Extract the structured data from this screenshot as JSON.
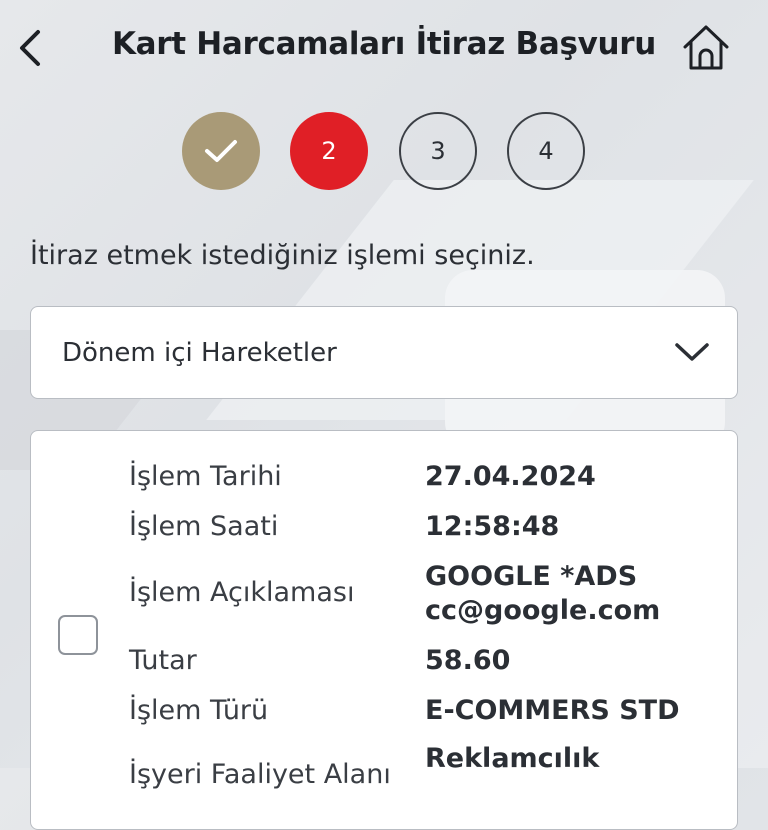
{
  "header": {
    "title": "Kart Harcamaları İtiraz Başvuru"
  },
  "steps": [
    {
      "label": "",
      "state": "done"
    },
    {
      "label": "2",
      "state": "active"
    },
    {
      "label": "3",
      "state": "todo"
    },
    {
      "label": "4",
      "state": "todo"
    }
  ],
  "instruction": "İtiraz etmek istediğiniz işlemi seçiniz.",
  "dropdown": {
    "selected": "Dönem içi Hareketler"
  },
  "transaction": {
    "checked": false,
    "rows": [
      {
        "label": "İşlem Tarihi",
        "value": "27.04.2024"
      },
      {
        "label": "İşlem Saati",
        "value": "12:58:48"
      },
      {
        "label": "İşlem Açıklaması",
        "value_line1": "GOOGLE *ADS",
        "value_line2": "cc@google.com"
      },
      {
        "label": "Tutar",
        "value": "58.60"
      },
      {
        "label": "İşlem Türü",
        "value": "E-COMMERS STD"
      },
      {
        "label": "İşyeri Faaliyet Alanı",
        "value": "Reklamcılık"
      }
    ]
  },
  "colors": {
    "accent_red": "#e01f26",
    "done_gold": "#a99a77"
  }
}
